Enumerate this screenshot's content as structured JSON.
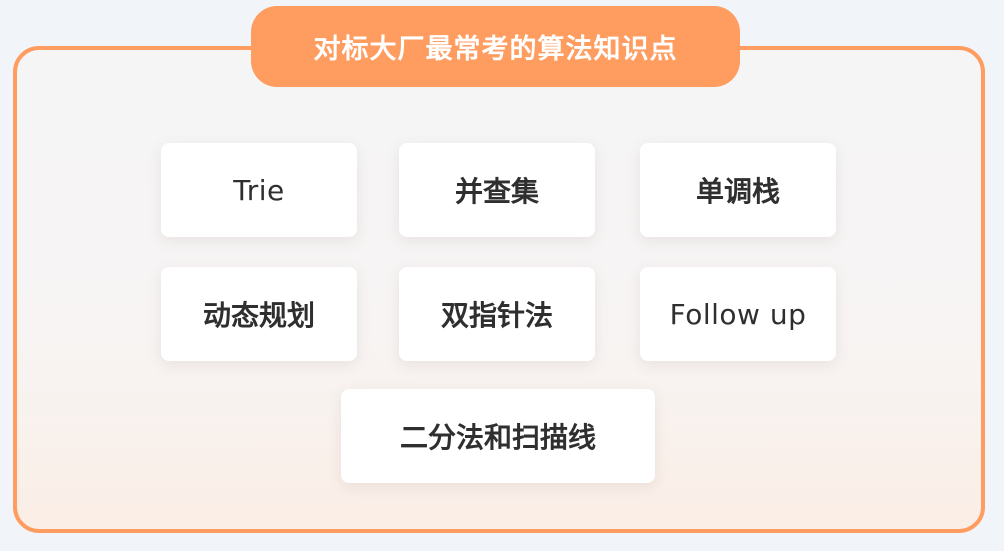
{
  "title": "对标大厂最常考的算法知识点",
  "topics": [
    {
      "label": "Trie"
    },
    {
      "label": "并查集"
    },
    {
      "label": "单调栈"
    },
    {
      "label": "动态规划"
    },
    {
      "label": "双指针法"
    },
    {
      "label": "Follow up"
    },
    {
      "label": "二分法和扫描线"
    }
  ],
  "colors": {
    "accent": "#ff9d61",
    "card_text": "#2f2f2f",
    "card_bg": "#ffffff"
  }
}
